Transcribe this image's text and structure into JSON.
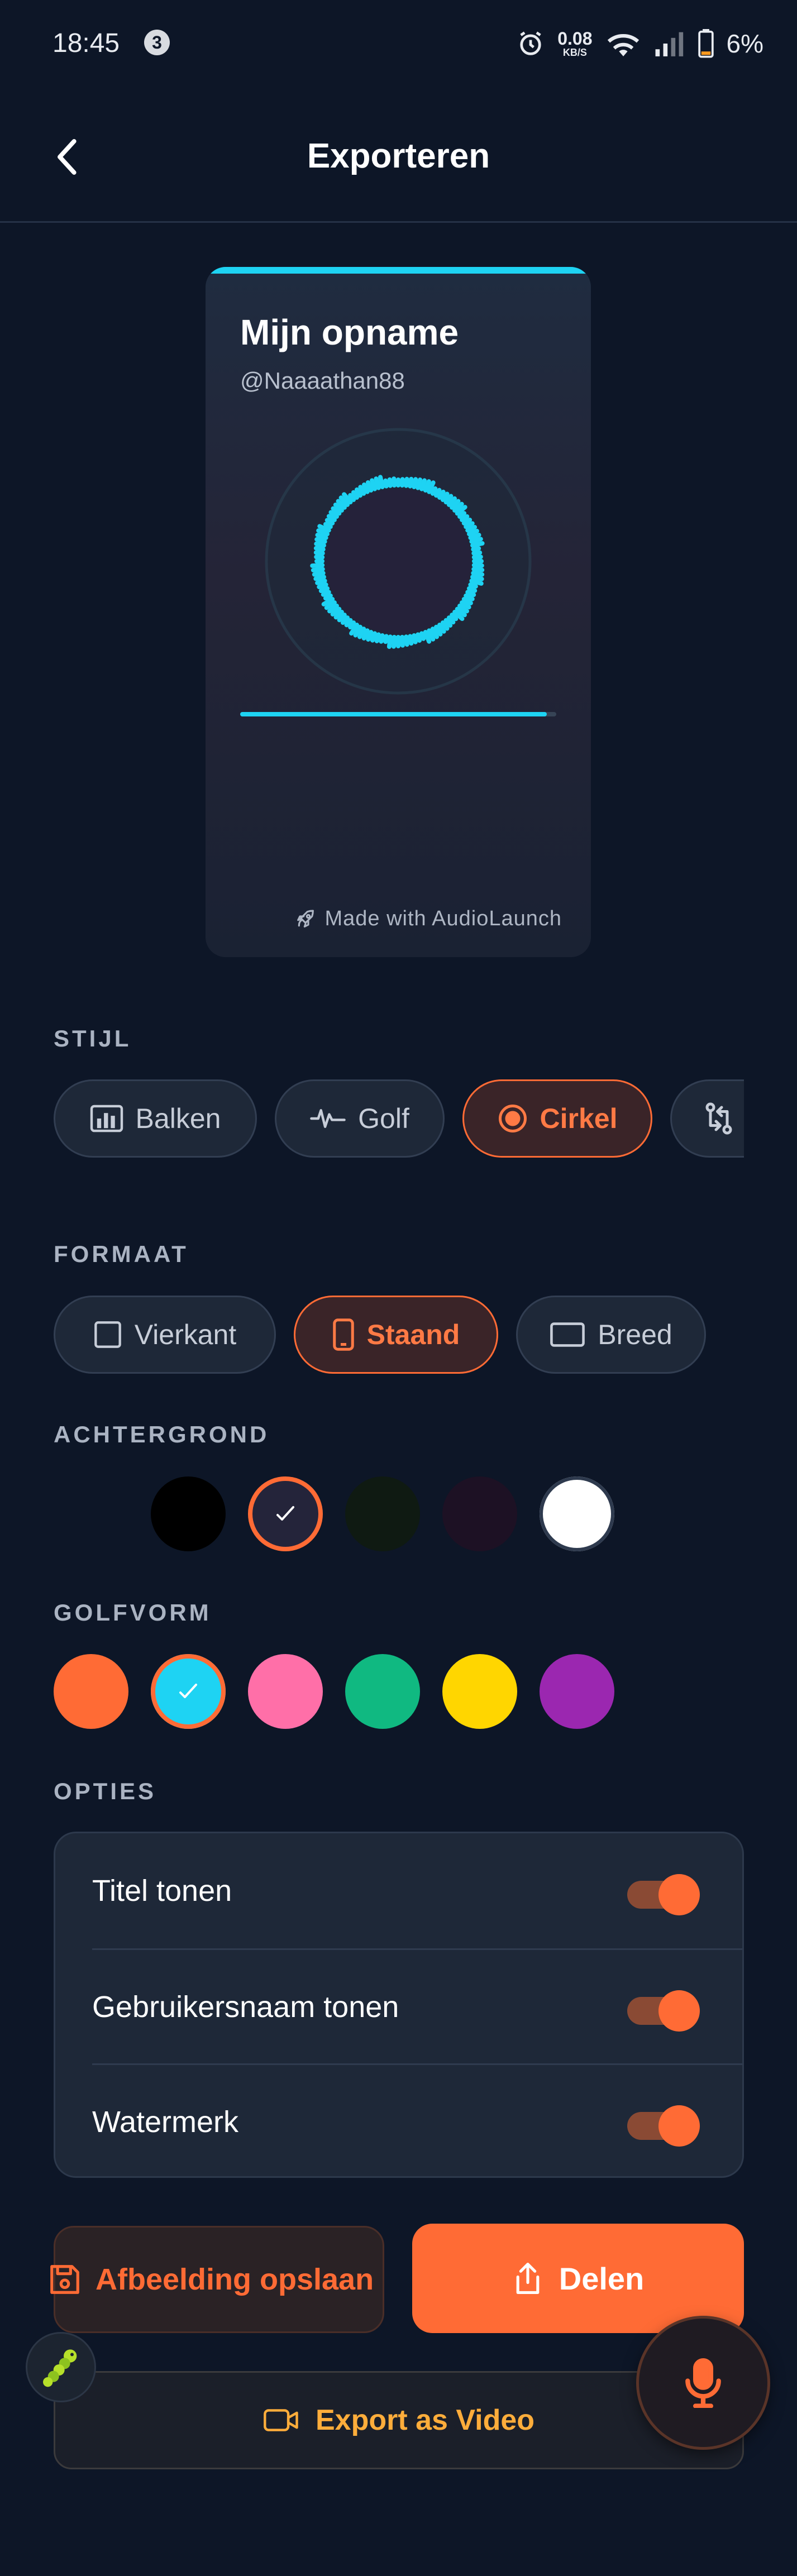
{
  "status": {
    "time": "18:45",
    "notif_count": "3",
    "speed_value": "0.08",
    "speed_unit": "KB/S",
    "battery": "6%"
  },
  "header": {
    "title": "Exporteren"
  },
  "preview": {
    "title": "Mijn opname",
    "username": "@Naaaathan88",
    "watermark": "Made with AudioLaunch",
    "progress": 0.97
  },
  "sections": {
    "style": "STIJL",
    "format": "FORMAAT",
    "background": "ACHTERGROND",
    "waveform": "GOLFVORM",
    "options": "OPTIES"
  },
  "styles": [
    {
      "label": "Balken",
      "icon": "bars-icon",
      "active": false
    },
    {
      "label": "Golf",
      "icon": "wave-icon",
      "active": false
    },
    {
      "label": "Cirkel",
      "icon": "circle-icon",
      "active": true
    },
    {
      "label": "",
      "icon": "swap-icon",
      "active": false
    }
  ],
  "formats": [
    {
      "label": "Vierkant",
      "icon": "square-icon",
      "active": false
    },
    {
      "label": "Staand",
      "icon": "portrait-icon",
      "active": true
    },
    {
      "label": "Breed",
      "icon": "landscape-icon",
      "active": false
    }
  ],
  "background_colors": [
    "#000000",
    "#24243a",
    "#0f1a12",
    "#1d1124",
    "#ffffff"
  ],
  "background_selected": 1,
  "wave_colors": [
    "#ff6b35",
    "#1ed3f3",
    "#ff6fa8",
    "#10b981",
    "#ffd600",
    "#9b27b0"
  ],
  "wave_selected": 1,
  "options": [
    {
      "label": "Titel tonen",
      "on": true
    },
    {
      "label": "Gebruikersnaam tonen",
      "on": true
    },
    {
      "label": "Watermerk",
      "on": true
    }
  ],
  "buttons": {
    "save": "Afbeelding opslaan",
    "share": "Delen",
    "video": "Export as Video"
  },
  "colors": {
    "accent": "#ff6b35",
    "wave": "#1ed3f3",
    "video_text": "#ffad3b"
  }
}
